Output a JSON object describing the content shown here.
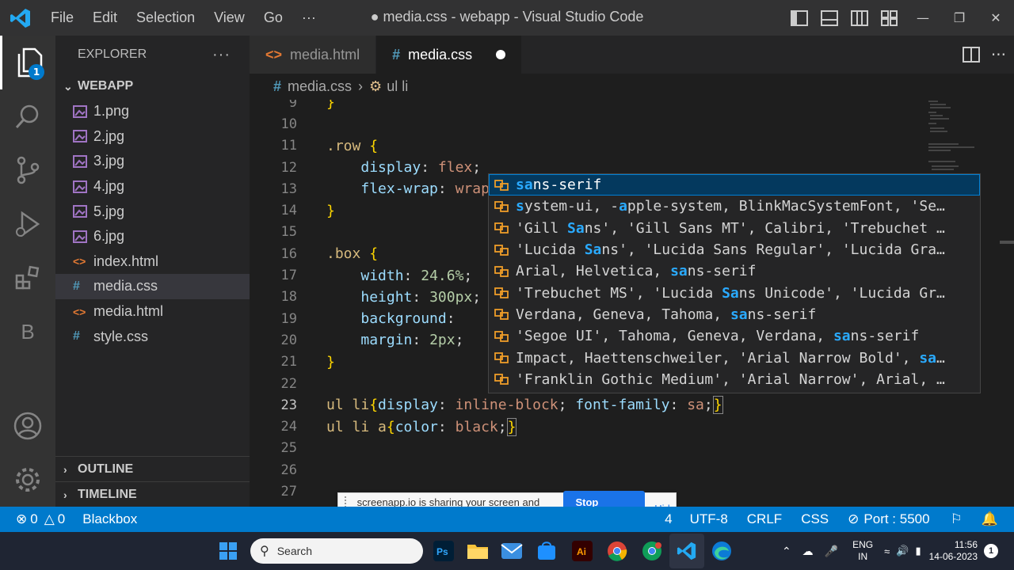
{
  "titlebar": {
    "menu": [
      "File",
      "Edit",
      "Selection",
      "View",
      "Go",
      "···"
    ],
    "title": "● media.css - webapp - Visual Studio Code"
  },
  "activity": {
    "explorer_badge": "1",
    "blackbox_letter": "B"
  },
  "sidebar": {
    "header": "EXPLORER",
    "more": "···",
    "folder": "WEBAPP",
    "files": [
      {
        "name": "1.png",
        "type": "img"
      },
      {
        "name": "2.jpg",
        "type": "img"
      },
      {
        "name": "3.jpg",
        "type": "img"
      },
      {
        "name": "4.jpg",
        "type": "img"
      },
      {
        "name": "5.jpg",
        "type": "img"
      },
      {
        "name": "6.jpg",
        "type": "img"
      },
      {
        "name": "index.html",
        "type": "html"
      },
      {
        "name": "media.css",
        "type": "css",
        "selected": true
      },
      {
        "name": "media.html",
        "type": "html"
      },
      {
        "name": "style.css",
        "type": "css"
      }
    ],
    "outline": "OUTLINE",
    "timeline": "TIMELINE"
  },
  "tabs": [
    {
      "label": "media.html",
      "icon": "<>",
      "active": false
    },
    {
      "label": "media.css",
      "icon": "#",
      "active": true,
      "dirty": true
    }
  ],
  "breadcrumb": {
    "file": "media.css",
    "symbol": "ul li"
  },
  "editor": {
    "lines": [
      {
        "n": "9",
        "code": "}"
      },
      {
        "n": "10",
        "code": ""
      },
      {
        "n": "11",
        "code": ".row {"
      },
      {
        "n": "12",
        "code": "    display: flex;"
      },
      {
        "n": "13",
        "code": "    flex-wrap: wrap"
      },
      {
        "n": "14",
        "code": "}"
      },
      {
        "n": "15",
        "code": ""
      },
      {
        "n": "16",
        "code": ".box {"
      },
      {
        "n": "17",
        "code": "    width: 24.6%;"
      },
      {
        "n": "18",
        "code": "    height: 300px;"
      },
      {
        "n": "19",
        "code": "    background:"
      },
      {
        "n": "20",
        "code": "    margin: 2px;"
      },
      {
        "n": "21",
        "code": "}"
      },
      {
        "n": "22",
        "code": ""
      },
      {
        "n": "23",
        "code": "ul li{display: inline-block; font-family: sa;}"
      },
      {
        "n": "24",
        "code": "ul li a{color: black;}"
      },
      {
        "n": "25",
        "code": ""
      },
      {
        "n": "26",
        "code": ""
      },
      {
        "n": "27",
        "code": ""
      }
    ],
    "current_line": "23"
  },
  "suggest": {
    "query": "sa",
    "items": [
      "sans-serif",
      "system-ui, -apple-system, BlinkMacSystemFont, 'Se…",
      "'Gill Sans', 'Gill Sans MT', Calibri, 'Trebuchet …",
      "'Lucida Sans', 'Lucida Sans Regular', 'Lucida Gra…",
      "Arial, Helvetica, sans-serif",
      "'Trebuchet MS', 'Lucida Sans Unicode', 'Lucida Gr…",
      "Verdana, Geneva, Tahoma, sans-serif",
      "'Segoe UI', Tahoma, Geneva, Verdana, sans-serif",
      "Impact, Haettenschweiler, 'Arial Narrow Bold', sa…",
      "'Franklin Gothic Medium', 'Arial Narrow', Arial, …"
    ]
  },
  "share": {
    "text": "screenapp.io is sharing your screen and audio.",
    "stop": "Stop sharing",
    "hide": "Hide"
  },
  "statusbar": {
    "errors": "0",
    "warnings": "0",
    "blackbox": "Blackbox",
    "col": "4",
    "encoding": "UTF-8",
    "eol": "CRLF",
    "language": "CSS",
    "port": "Port : 5500"
  },
  "taskbar": {
    "search": "Search",
    "lang1": "ENG",
    "lang2": "IN",
    "time": "11:56",
    "date": "14-06-2023",
    "notifications": "1"
  },
  "colors": {
    "accent": "#007acc",
    "activity_bg": "#333333",
    "sidebar_bg": "#252526",
    "editor_bg": "#1e1e1e",
    "suggest_focus": "#04395e"
  }
}
